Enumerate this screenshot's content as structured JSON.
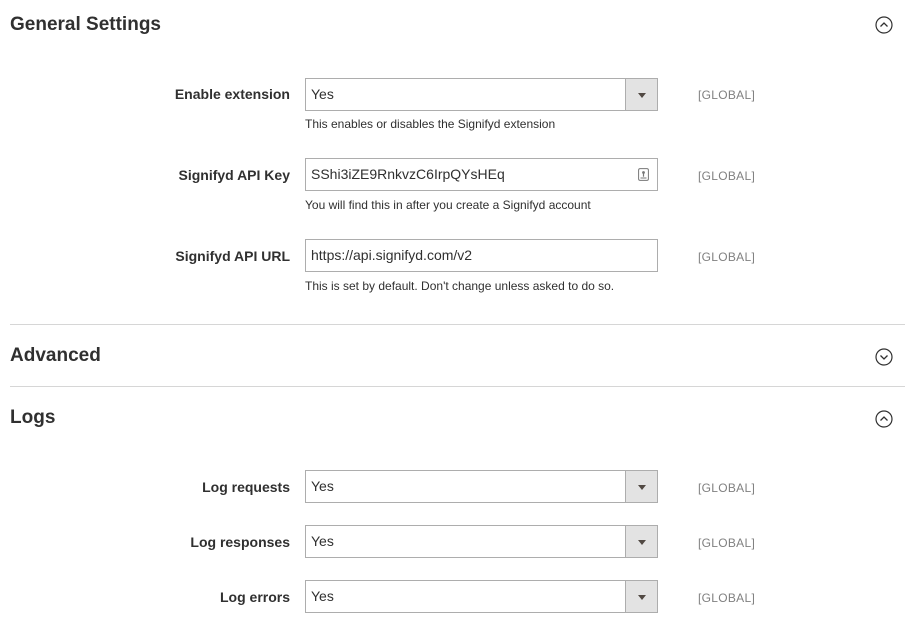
{
  "sections": {
    "general": {
      "title": "General Settings",
      "expanded": true,
      "toggle_icon": "chevron-up-circle-icon",
      "fields": {
        "enable_extension": {
          "label": "Enable extension",
          "value": "Yes",
          "note": "This enables or disables the Signifyd extension",
          "scope": "[GLOBAL]"
        },
        "api_key": {
          "label": "Signifyd API Key",
          "value": "SShi3iZE9RnkvzC6IrpQYsHEq",
          "note": "You will find this in after you create a Signifyd account",
          "scope": "[GLOBAL]"
        },
        "api_url": {
          "label": "Signifyd API URL",
          "value": "https://api.signifyd.com/v2",
          "note": "This is set by default. Don't change unless asked to do so.",
          "scope": "[GLOBAL]"
        }
      }
    },
    "advanced": {
      "title": "Advanced",
      "expanded": false,
      "toggle_icon": "chevron-down-circle-icon"
    },
    "logs": {
      "title": "Logs",
      "expanded": true,
      "toggle_icon": "chevron-up-circle-icon",
      "fields": {
        "log_requests": {
          "label": "Log requests",
          "value": "Yes",
          "scope": "[GLOBAL]"
        },
        "log_responses": {
          "label": "Log responses",
          "value": "Yes",
          "scope": "[GLOBAL]"
        },
        "log_errors": {
          "label": "Log errors",
          "value": "Yes",
          "scope": "[GLOBAL]"
        }
      }
    }
  },
  "colors": {
    "text": "#303030",
    "muted": "#808080",
    "border": "#adadad",
    "select_button": "#e3e3e3",
    "divider": "#d6d6d6"
  }
}
